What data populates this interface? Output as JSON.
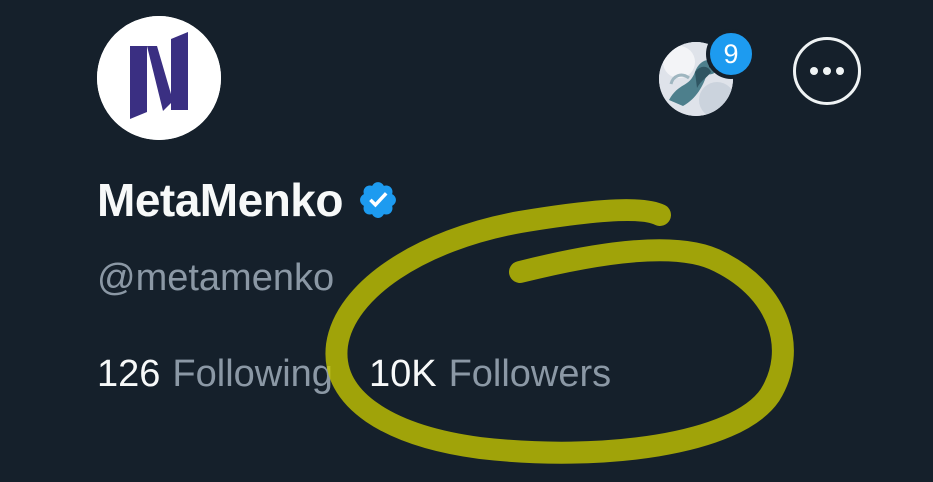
{
  "profile": {
    "display_name": "MetaMenko",
    "handle": "@metamenko",
    "verified_icon": "verified-badge-icon",
    "avatar_icon": "metamenko-logo",
    "brand_color": "#3a2f82"
  },
  "header": {
    "account_badge_count": "9",
    "more_icon": "more-horizontal-icon"
  },
  "stats": {
    "following_count": "126",
    "following_label": "Following",
    "followers_count": "10K",
    "followers_label": "Followers"
  },
  "colors": {
    "background": "#15202b",
    "text_primary": "#f7f9f9",
    "text_secondary": "#8b98a5",
    "accent": "#1d9bf0",
    "annotation": "#c8c800"
  }
}
